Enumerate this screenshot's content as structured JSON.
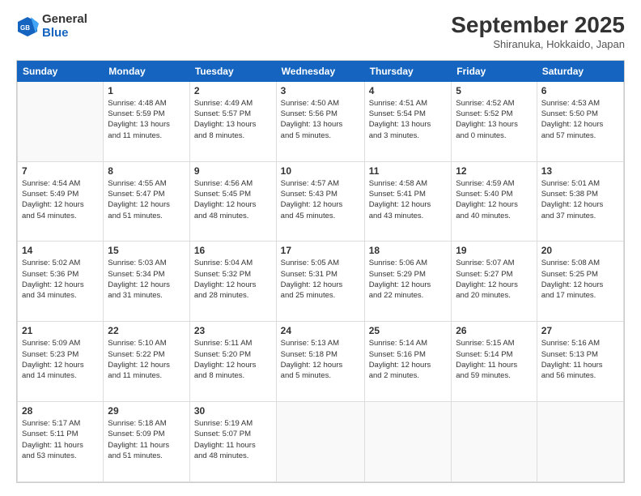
{
  "logo": {
    "general": "General",
    "blue": "Blue"
  },
  "header": {
    "month": "September 2025",
    "location": "Shiranuka, Hokkaido, Japan"
  },
  "weekdays": [
    "Sunday",
    "Monday",
    "Tuesday",
    "Wednesday",
    "Thursday",
    "Friday",
    "Saturday"
  ],
  "weeks": [
    [
      {
        "day": "",
        "info": ""
      },
      {
        "day": "1",
        "info": "Sunrise: 4:48 AM\nSunset: 5:59 PM\nDaylight: 13 hours\nand 11 minutes."
      },
      {
        "day": "2",
        "info": "Sunrise: 4:49 AM\nSunset: 5:57 PM\nDaylight: 13 hours\nand 8 minutes."
      },
      {
        "day": "3",
        "info": "Sunrise: 4:50 AM\nSunset: 5:56 PM\nDaylight: 13 hours\nand 5 minutes."
      },
      {
        "day": "4",
        "info": "Sunrise: 4:51 AM\nSunset: 5:54 PM\nDaylight: 13 hours\nand 3 minutes."
      },
      {
        "day": "5",
        "info": "Sunrise: 4:52 AM\nSunset: 5:52 PM\nDaylight: 13 hours\nand 0 minutes."
      },
      {
        "day": "6",
        "info": "Sunrise: 4:53 AM\nSunset: 5:50 PM\nDaylight: 12 hours\nand 57 minutes."
      }
    ],
    [
      {
        "day": "7",
        "info": "Sunrise: 4:54 AM\nSunset: 5:49 PM\nDaylight: 12 hours\nand 54 minutes."
      },
      {
        "day": "8",
        "info": "Sunrise: 4:55 AM\nSunset: 5:47 PM\nDaylight: 12 hours\nand 51 minutes."
      },
      {
        "day": "9",
        "info": "Sunrise: 4:56 AM\nSunset: 5:45 PM\nDaylight: 12 hours\nand 48 minutes."
      },
      {
        "day": "10",
        "info": "Sunrise: 4:57 AM\nSunset: 5:43 PM\nDaylight: 12 hours\nand 45 minutes."
      },
      {
        "day": "11",
        "info": "Sunrise: 4:58 AM\nSunset: 5:41 PM\nDaylight: 12 hours\nand 43 minutes."
      },
      {
        "day": "12",
        "info": "Sunrise: 4:59 AM\nSunset: 5:40 PM\nDaylight: 12 hours\nand 40 minutes."
      },
      {
        "day": "13",
        "info": "Sunrise: 5:01 AM\nSunset: 5:38 PM\nDaylight: 12 hours\nand 37 minutes."
      }
    ],
    [
      {
        "day": "14",
        "info": "Sunrise: 5:02 AM\nSunset: 5:36 PM\nDaylight: 12 hours\nand 34 minutes."
      },
      {
        "day": "15",
        "info": "Sunrise: 5:03 AM\nSunset: 5:34 PM\nDaylight: 12 hours\nand 31 minutes."
      },
      {
        "day": "16",
        "info": "Sunrise: 5:04 AM\nSunset: 5:32 PM\nDaylight: 12 hours\nand 28 minutes."
      },
      {
        "day": "17",
        "info": "Sunrise: 5:05 AM\nSunset: 5:31 PM\nDaylight: 12 hours\nand 25 minutes."
      },
      {
        "day": "18",
        "info": "Sunrise: 5:06 AM\nSunset: 5:29 PM\nDaylight: 12 hours\nand 22 minutes."
      },
      {
        "day": "19",
        "info": "Sunrise: 5:07 AM\nSunset: 5:27 PM\nDaylight: 12 hours\nand 20 minutes."
      },
      {
        "day": "20",
        "info": "Sunrise: 5:08 AM\nSunset: 5:25 PM\nDaylight: 12 hours\nand 17 minutes."
      }
    ],
    [
      {
        "day": "21",
        "info": "Sunrise: 5:09 AM\nSunset: 5:23 PM\nDaylight: 12 hours\nand 14 minutes."
      },
      {
        "day": "22",
        "info": "Sunrise: 5:10 AM\nSunset: 5:22 PM\nDaylight: 12 hours\nand 11 minutes."
      },
      {
        "day": "23",
        "info": "Sunrise: 5:11 AM\nSunset: 5:20 PM\nDaylight: 12 hours\nand 8 minutes."
      },
      {
        "day": "24",
        "info": "Sunrise: 5:13 AM\nSunset: 5:18 PM\nDaylight: 12 hours\nand 5 minutes."
      },
      {
        "day": "25",
        "info": "Sunrise: 5:14 AM\nSunset: 5:16 PM\nDaylight: 12 hours\nand 2 minutes."
      },
      {
        "day": "26",
        "info": "Sunrise: 5:15 AM\nSunset: 5:14 PM\nDaylight: 11 hours\nand 59 minutes."
      },
      {
        "day": "27",
        "info": "Sunrise: 5:16 AM\nSunset: 5:13 PM\nDaylight: 11 hours\nand 56 minutes."
      }
    ],
    [
      {
        "day": "28",
        "info": "Sunrise: 5:17 AM\nSunset: 5:11 PM\nDaylight: 11 hours\nand 53 minutes."
      },
      {
        "day": "29",
        "info": "Sunrise: 5:18 AM\nSunset: 5:09 PM\nDaylight: 11 hours\nand 51 minutes."
      },
      {
        "day": "30",
        "info": "Sunrise: 5:19 AM\nSunset: 5:07 PM\nDaylight: 11 hours\nand 48 minutes."
      },
      {
        "day": "",
        "info": ""
      },
      {
        "day": "",
        "info": ""
      },
      {
        "day": "",
        "info": ""
      },
      {
        "day": "",
        "info": ""
      }
    ]
  ]
}
